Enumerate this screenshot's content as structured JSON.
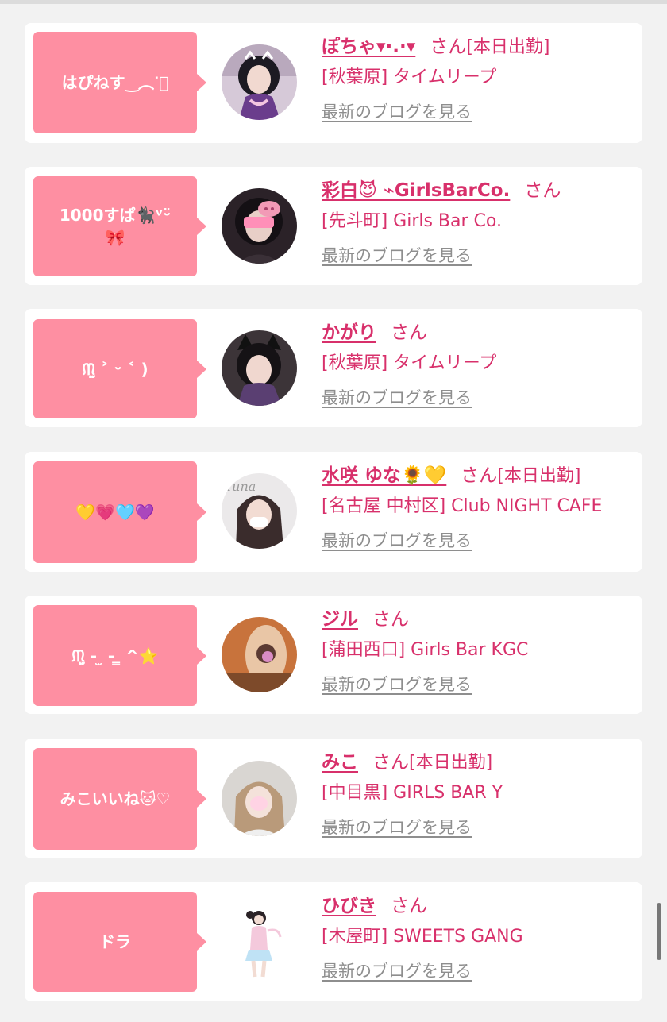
{
  "colors": {
    "accent": "#d8306b",
    "bubble": "#fe8fa2",
    "link_gray": "#8e8e8e",
    "background": "#f2f2f2"
  },
  "blog_label": "最新のブログを見る",
  "items": [
    {
      "comment": "はぴねす‿︵ᐝ͛",
      "name": "ぽちゃ▾·.·▾",
      "san": "さん",
      "work_status": "[本日出勤]",
      "shop": "[秋葉原] タイムリープ",
      "avatar_icon": "girl-photo-avatar-purple-kimono"
    },
    {
      "comment": "1000すぱ🐈‍⬛ᵛᵕ̈\n🎀",
      "name": "彩白😈 ⌁GirlsBarCo.",
      "san": "さん",
      "work_status": "",
      "shop": "[先斗町] Girls Bar Co.",
      "avatar_icon": "girl-photo-avatar-pig-mask"
    },
    {
      "comment": "ᙏ̤̫ ˃ ᵕ ˂ )",
      "name": "かがり",
      "san": "さん",
      "work_status": "",
      "shop": "[秋葉原] タイムリープ",
      "avatar_icon": "girl-photo-avatar-cat-ears"
    },
    {
      "comment": "💛💗🩵💜",
      "name": "水咲 ゆな🌻💛",
      "san": "さん",
      "work_status": "[本日出勤]",
      "shop": "[名古屋 中村区] Club NIGHT CAFE",
      "avatar_icon": "girl-photo-avatar-mask"
    },
    {
      "comment": "ᙏ̤̫ - ̫ - ̳ ^⭐",
      "name": "ジル",
      "san": "さん",
      "work_status": "",
      "shop": "[蒲田西口] Girls Bar KGC",
      "avatar_icon": "girl-photo-avatar-mirror"
    },
    {
      "comment": "みこいいね🐱♡",
      "name": "みこ",
      "san": "さん",
      "work_status": "[本日出勤]",
      "shop": "[中目黒] GIRLS BAR Y",
      "avatar_icon": "girl-photo-avatar-blonde"
    },
    {
      "comment": "ドラ",
      "name": "ひびき",
      "san": "さん",
      "work_status": "",
      "shop": "[木屋町] SWEETS GANG",
      "avatar_icon": "girl-photo-avatar-full-body"
    }
  ]
}
